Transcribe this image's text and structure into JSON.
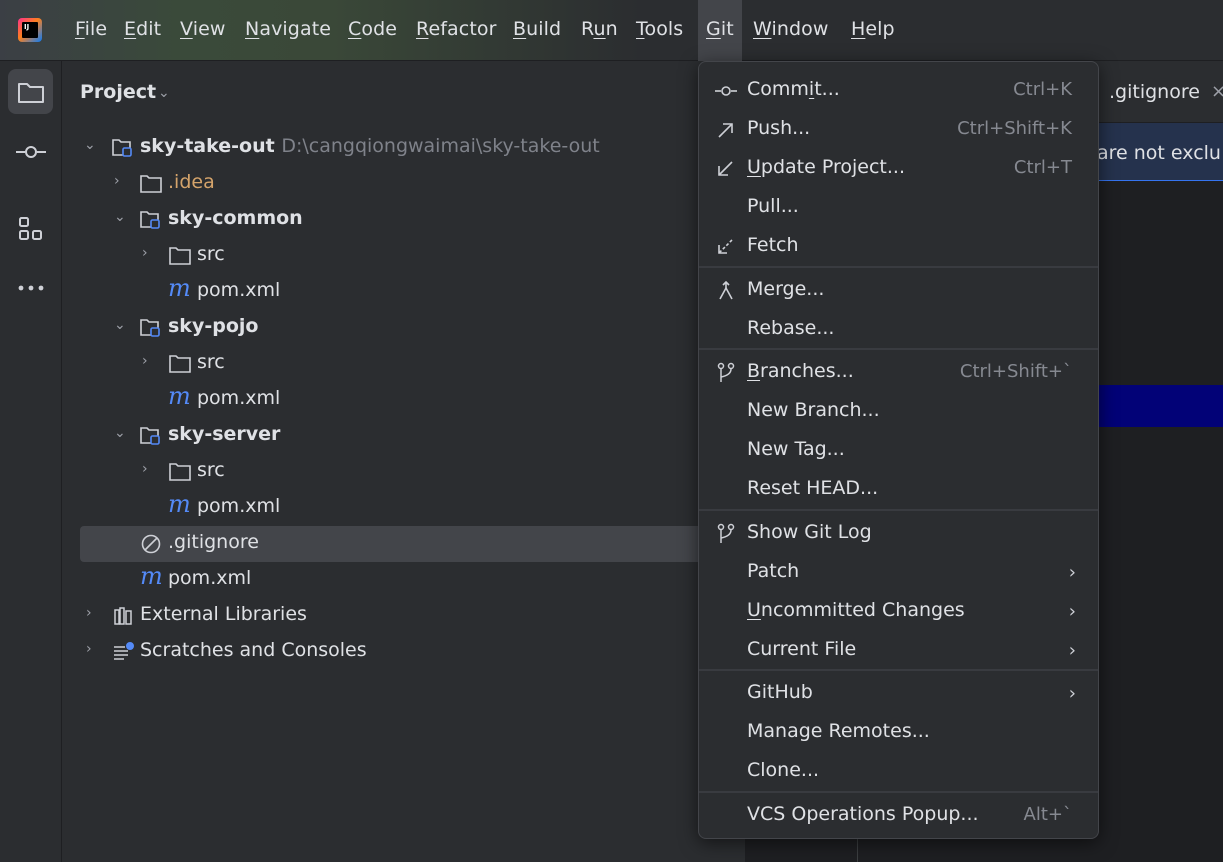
{
  "menubar": {
    "logo": "IJ",
    "items": [
      {
        "pre": "",
        "u": "F",
        "post": "ile"
      },
      {
        "pre": "",
        "u": "E",
        "post": "dit"
      },
      {
        "pre": "",
        "u": "V",
        "post": "iew"
      },
      {
        "pre": "",
        "u": "N",
        "post": "avigate"
      },
      {
        "pre": "",
        "u": "C",
        "post": "ode"
      },
      {
        "pre": "",
        "u": "R",
        "post": "efactor"
      },
      {
        "pre": "",
        "u": "B",
        "post": "uild"
      },
      {
        "pre": "R",
        "u": "u",
        "post": "n"
      },
      {
        "pre": "",
        "u": "T",
        "post": "ools"
      },
      {
        "pre": "",
        "u": "G",
        "post": "it"
      },
      {
        "pre": "",
        "u": "W",
        "post": "indow"
      },
      {
        "pre": "",
        "u": "H",
        "post": "elp"
      }
    ]
  },
  "project": {
    "title": "Project",
    "root": {
      "name": "sky-take-out",
      "path": "D:\\cangqiongwaimai\\sky-take-out"
    },
    "idea": ".idea",
    "modules": [
      {
        "name": "sky-common",
        "src": "src",
        "pom": "pom.xml"
      },
      {
        "name": "sky-pojo",
        "src": "src",
        "pom": "pom.xml"
      },
      {
        "name": "sky-server",
        "src": "src",
        "pom": "pom.xml"
      }
    ],
    "gitignore": ".gitignore",
    "root_pom": "pom.xml",
    "external_libraries": "External Libraries",
    "scratches": "Scratches and Consoles"
  },
  "editor": {
    "tab": ".gitignore",
    "banner": "are not exclu"
  },
  "git_menu": {
    "commit": {
      "pre": "Comm",
      "u": "i",
      "post": "t...",
      "shortcut": "Ctrl+K"
    },
    "push": {
      "label": "Push...",
      "shortcut": "Ctrl+Shift+K"
    },
    "update": {
      "pre": "",
      "u": "U",
      "post": "pdate Project...",
      "shortcut": "Ctrl+T"
    },
    "pull": "Pull...",
    "fetch": "Fetch",
    "merge": "Merge...",
    "rebase": "Rebase...",
    "branches": {
      "pre": "",
      "u": "B",
      "post": "ranches...",
      "shortcut": "Ctrl+Shift+`"
    },
    "new_branch": "New Branch...",
    "new_tag": "New Tag...",
    "reset_head": "Reset HEAD...",
    "show_git_log": "Show Git Log",
    "patch": "Patch",
    "uncommitted": {
      "pre": "",
      "u": "U",
      "post": "ncommitted Changes"
    },
    "current_file": "Current File",
    "github": "GitHub",
    "manage_remotes": "Manage Remotes...",
    "clone": "Clone...",
    "vcs_popup": {
      "label": "VCS Operations Popup...",
      "shortcut": "Alt+`"
    }
  }
}
